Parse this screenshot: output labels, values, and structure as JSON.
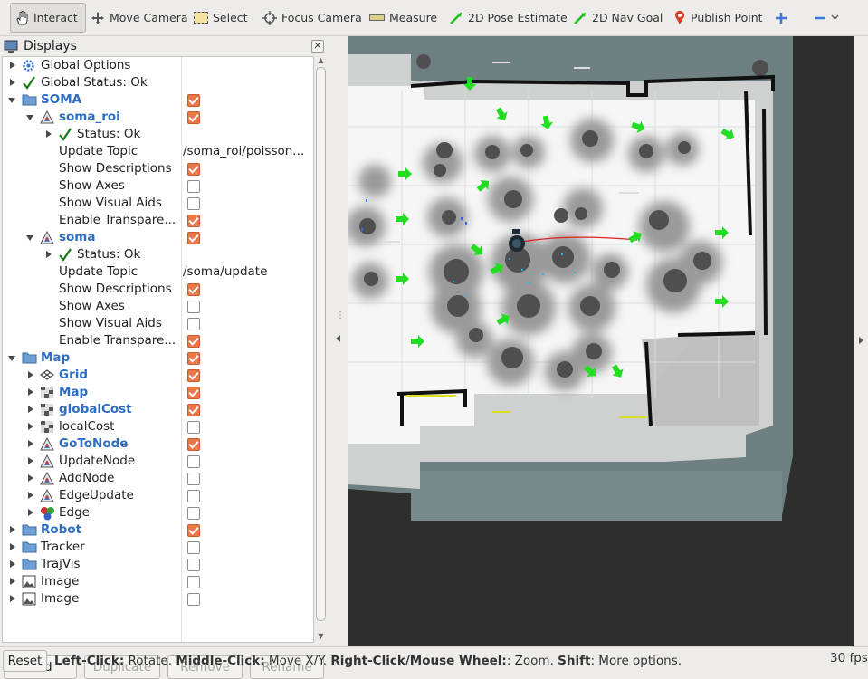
{
  "toolbar": {
    "interact": "Interact",
    "move_camera": "Move Camera",
    "select": "Select",
    "focus_camera": "Focus Camera",
    "measure": "Measure",
    "pose_estimate": "2D Pose Estimate",
    "nav_goal": "2D Nav Goal",
    "publish_point": "Publish Point"
  },
  "displays": {
    "title": "Displays",
    "rows": [
      {
        "label": "Global Options"
      },
      {
        "label": "Global Status: Ok"
      },
      {
        "label": "SOMA",
        "checked": true
      },
      {
        "label": "soma_roi",
        "checked": true
      },
      {
        "label": "Status: Ok"
      },
      {
        "label": "Update Topic",
        "value": "/soma_roi/poisson..."
      },
      {
        "label": "Show Descriptions",
        "checked": true
      },
      {
        "label": "Show Axes",
        "checked": false
      },
      {
        "label": "Show Visual Aids",
        "checked": false
      },
      {
        "label": "Enable Transpare...",
        "checked": true
      },
      {
        "label": "soma",
        "checked": true
      },
      {
        "label": "Status: Ok"
      },
      {
        "label": "Update Topic",
        "value": "/soma/update"
      },
      {
        "label": "Show Descriptions",
        "checked": true
      },
      {
        "label": "Show Axes",
        "checked": false
      },
      {
        "label": "Show Visual Aids",
        "checked": false
      },
      {
        "label": "Enable Transpare...",
        "checked": true
      },
      {
        "label": "Map",
        "checked": true
      },
      {
        "label": "Grid",
        "checked": true
      },
      {
        "label": "Map",
        "checked": true
      },
      {
        "label": "globalCost",
        "checked": true
      },
      {
        "label": "localCost",
        "checked": false
      },
      {
        "label": "GoToNode",
        "checked": true
      },
      {
        "label": "UpdateNode",
        "checked": false
      },
      {
        "label": "AddNode",
        "checked": false
      },
      {
        "label": "EdgeUpdate",
        "checked": false
      },
      {
        "label": "Edge",
        "checked": false
      },
      {
        "label": "Robot",
        "checked": true
      },
      {
        "label": "Tracker",
        "checked": false
      },
      {
        "label": "TrajVis",
        "checked": false
      },
      {
        "label": "Image",
        "checked": false
      },
      {
        "label": "Image",
        "checked": false
      }
    ]
  },
  "buttons": {
    "add": "Add",
    "duplicate": "Duplicate",
    "remove": "Remove",
    "rename": "Rename"
  },
  "status": {
    "reset": "Reset",
    "hint_left_key": "Left-Click:",
    "hint_left": " Rotate. ",
    "hint_middle_key": "Middle-Click:",
    "hint_middle": " Move X/Y. ",
    "hint_right_key": "Right-Click/Mouse Wheel:",
    "hint_right": ": Zoom. ",
    "hint_shift_key": "Shift",
    "hint_shift": ": More options.",
    "fps": "30 fps"
  },
  "colors": {
    "accent_checkbox": "#e8794a",
    "blue_label": "#2d6dc2",
    "goal_arrow": "#22dd22",
    "path": "#dd2222"
  }
}
